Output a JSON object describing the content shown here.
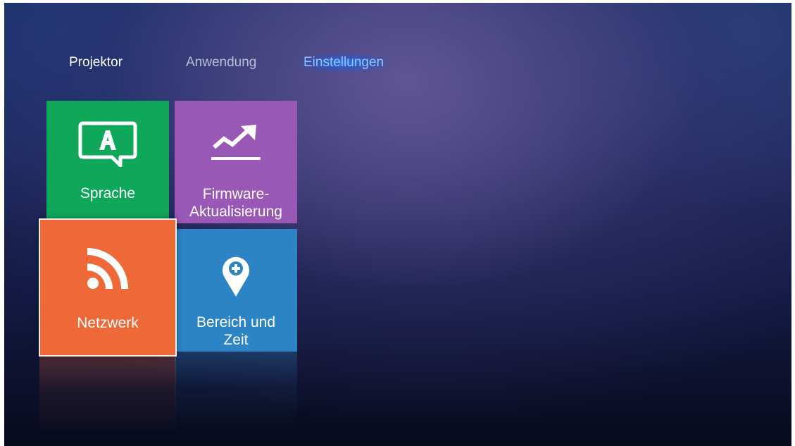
{
  "tabs": {
    "projektor": "Projektor",
    "anwendung": "Anwendung",
    "einstellungen": "Einstellungen",
    "selected": "einstellungen"
  },
  "tiles": {
    "sprache": {
      "label": "Sprache",
      "icon": "language-icon",
      "color": "#0fa85a"
    },
    "firmware": {
      "line1": "Firmware-",
      "line2": "Aktualisierung",
      "icon": "firmware-update-icon",
      "color": "#9a58b6"
    },
    "netzwerk": {
      "label": "Netzwerk",
      "icon": "network-icon",
      "color": "#ee6838",
      "focused": true
    },
    "bereich": {
      "line1": "Bereich und",
      "line2": "Zeit",
      "icon": "region-pin-icon",
      "color": "#2d84c4"
    }
  },
  "colors": {
    "tab_selected_text": "#8fc4ff",
    "tab_selected_glow": "#2878ff"
  }
}
